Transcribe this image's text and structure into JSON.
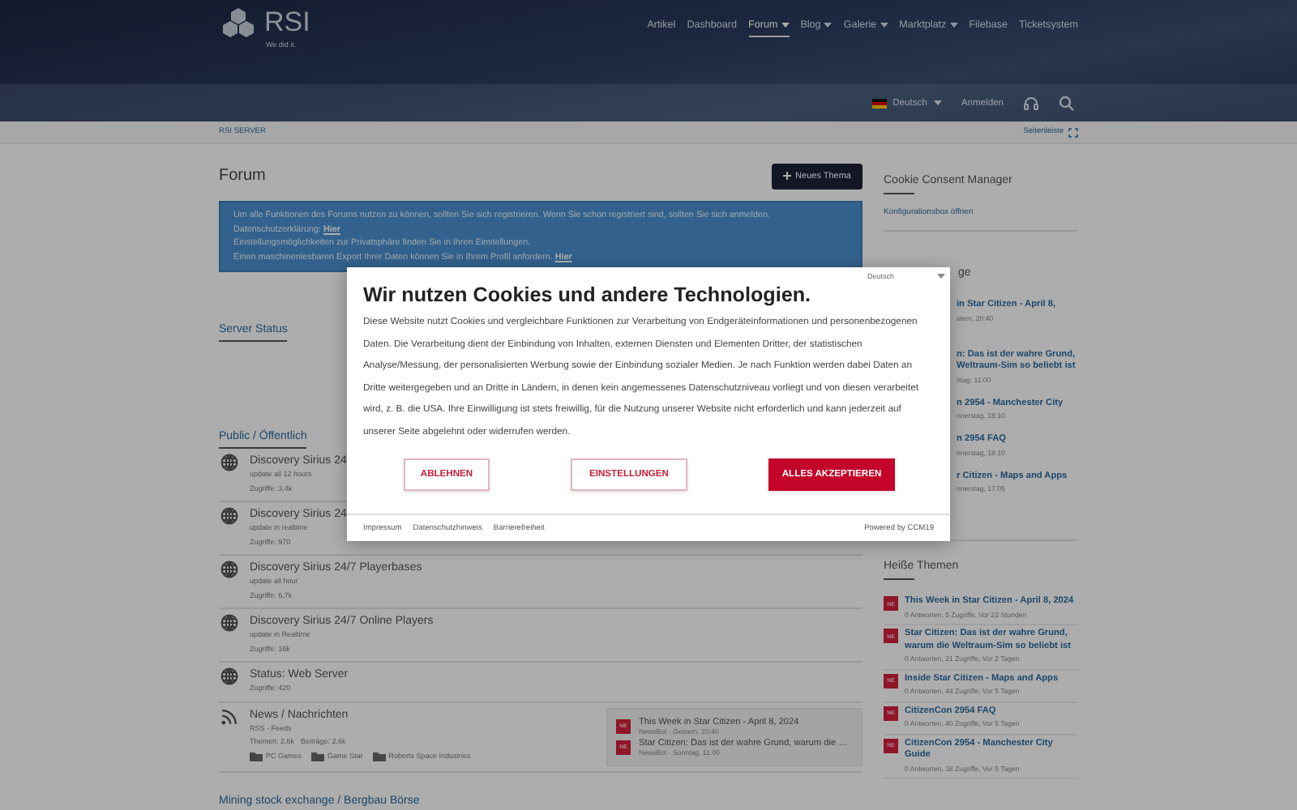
{
  "header": {
    "logo": "RSI",
    "tagline": "We did it.",
    "nav": [
      {
        "label": "Artikel",
        "selected": false,
        "has_menu": false
      },
      {
        "label": "Dashboard",
        "selected": false,
        "has_menu": false
      },
      {
        "label": "Forum",
        "selected": true,
        "has_menu": true
      },
      {
        "label": "Blog",
        "selected": false,
        "has_menu": true
      },
      {
        "label": "Galerie",
        "selected": false,
        "has_menu": true
      },
      {
        "label": "Marktplatz",
        "selected": false,
        "has_menu": true
      },
      {
        "label": "Filebase",
        "selected": false,
        "has_menu": false
      },
      {
        "label": "Ticketsystem",
        "selected": false,
        "has_menu": false
      }
    ],
    "language": "Deutsch",
    "login": "Anmelden"
  },
  "breadcrumb": {
    "label": "RSI SERVER",
    "sidebar_toggle": "Seitenleiste"
  },
  "main": {
    "title": "Forum",
    "new_topic": "Neues Thema",
    "notice": [
      {
        "text": "Um alle Funktionen des Forums nutzen zu können, sollten Sie sich registrieren. Wenn Sie schon registriert sind, sollten Sie sich anmelden."
      },
      {
        "text": "Datenschutzerklärung:",
        "link": "Hier"
      },
      {
        "text": "Einstellungsmöglichkeiten zur Privatsphäre finden Sie in Ihren Einstellungen."
      },
      {
        "text": "Einen maschinenlesbaren Export Ihrer Daten können Sie in Ihrem Profil anfordern.",
        "link": "Hier"
      }
    ],
    "sections": [
      {
        "title": "Server Status"
      },
      {
        "title": "Public / Öffentlich",
        "boards": [
          {
            "kind": "globe",
            "title": "Discovery Sirius 24",
            "description": "update all 12 hours",
            "stats": [
              "Zugriffe: 3,4k"
            ]
          },
          {
            "kind": "globe",
            "title": "Discovery Sirius 24",
            "description": "update in realtime",
            "stats": [
              "Zugriffe: 970"
            ]
          },
          {
            "kind": "globe",
            "title": "Discovery Sirius 24/7 Playerbases",
            "description": "update all hour",
            "stats": [
              "Zugriffe: 6,7k"
            ]
          },
          {
            "kind": "globe",
            "title": "Discovery Sirius 24/7 Online Players",
            "description": "update in Realtime",
            "stats": [
              "Zugriffe: 16k"
            ]
          },
          {
            "kind": "globe",
            "title": "Status: Web Server",
            "stats": [
              "Zugriffe: 420"
            ]
          },
          {
            "kind": "rss",
            "title": "News / Nachrichten",
            "description": "RSS - Feeds",
            "stats": [
              "Themen: 2,6k",
              "Beiträge: 2,6k"
            ],
            "subforums": [
              "PC Games",
              "Game Star",
              "Roberts Space Industries"
            ],
            "latest": [
              {
                "avatar": "NE",
                "title": "This Week in Star Citizen - April 8, 2024",
                "meta": "NewsBot · Gestern, 20:40"
              },
              {
                "avatar": "NE",
                "title": "Star Citizen: Das ist der wahre Grund, warum die …",
                "meta": "NewsBot · Sonntag, 11:00"
              }
            ]
          }
        ]
      },
      {
        "title": "Mining stock exchange / Bergbau Börse"
      }
    ]
  },
  "sidebar": {
    "cookie_box": {
      "title": "Cookie Consent Manager",
      "link": "Konfigurationsbox öffnen"
    },
    "latest_box": {
      "title": "ge",
      "items": [
        {
          "title": "in Star Citizen - April 8,",
          "meta": "stern, 20:40"
        },
        {
          "title": "n: Das ist der wahre Grund,",
          "title_2": "Weltraum-Sim so beliebt ist",
          "meta": "ntag, 11:00"
        },
        {
          "title": "n 2954 - Manchester City",
          "meta": "nnerstag, 18:10"
        },
        {
          "title": "n 2954 FAQ",
          "meta": "nnerstag, 18:10"
        },
        {
          "title": "r Citizen - Maps and Apps",
          "meta": "nnerstag, 17:05"
        }
      ]
    },
    "hot_box": {
      "title": "Heiße Themen",
      "items": [
        {
          "avatar": "NE",
          "title": "This Week in Star Citizen - April 8, 2024",
          "meta": "0 Antworten, 5 Zugriffe, Vor 22 Stunden"
        },
        {
          "avatar": "NE",
          "title": "Star Citizen: Das ist der wahre Grund, warum die Weltraum-Sim so beliebt ist",
          "meta": "0 Antworten, 21 Zugriffe, Vor 2 Tagen"
        },
        {
          "avatar": "NE",
          "title": "Inside Star Citizen - Maps and Apps",
          "meta": "0 Antworten, 44 Zugriffe, Vor 5 Tagen"
        },
        {
          "avatar": "NE",
          "title": "CitizenCon 2954 FAQ",
          "meta": "0 Antworten, 40 Zugriffe, Vor 5 Tagen"
        },
        {
          "avatar": "NE",
          "title": "CitizenCon 2954 - Manchester City Guide",
          "meta": "0 Antworten, 38 Zugriffe, Vor 5 Tagen"
        }
      ]
    }
  },
  "cookie_dialog": {
    "language": "Deutsch",
    "title": "Wir nutzen Cookies und andere Technologien.",
    "body": "Diese Website nutzt Cookies und vergleichbare Funktionen zur Verarbeitung von Endgeräteinformationen und personenbezogenen Daten. Die Verarbeitung dient der Einbindung von Inhalten, externen Diensten und Elementen Dritter, der statistischen Analyse/Messung, der personalisierten Werbung sowie der Einbindung sozialer Medien. Je nach Funktion werden dabei Daten an Dritte weitergegeben und an Dritte in Ländern, in denen kein angemessenes Datenschutzniveau vorliegt und von diesen verarbeitet wird, z. B. die USA. Ihre Einwilligung ist stets freiwillig, für die Nutzung unserer Website nicht erforderlich und kann jederzeit auf unserer Seite abgelehnt oder widerrufen werden.",
    "buttons": [
      {
        "label": "ABLEHNEN",
        "kind": "outline"
      },
      {
        "label": "EINSTELLUNGEN",
        "kind": "outline"
      },
      {
        "label": "ALLES AKZEPTIEREN",
        "kind": "primary"
      }
    ],
    "footer_links": [
      "Impressum",
      "Datenschutzhinweis",
      "Barrierefreiheit"
    ],
    "powered_by": "Powered by CCM19"
  }
}
